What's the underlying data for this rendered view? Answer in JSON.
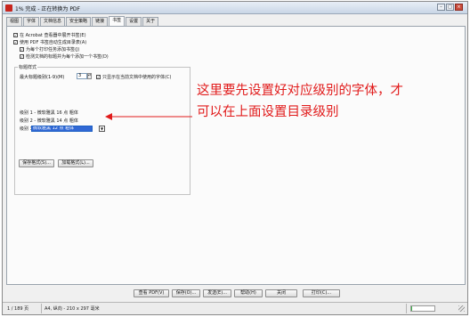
{
  "window": {
    "title": "1% 完成 - 正在转换为 PDF",
    "minimize_glyph": "–",
    "maximize_glyph": "□",
    "close_glyph": "×"
  },
  "tabs": [
    "视图",
    "字体",
    "文档信息",
    "安全策略",
    "链接",
    "书签",
    "设置",
    "关于"
  ],
  "active_tab": "书签",
  "bookmarks": {
    "options": [
      {
        "label": "在 Acrobat 查看器中展开书签(E)",
        "checked": true
      },
      {
        "label": "使用 PDF 书签自动生成目录表(A)",
        "checked": true
      },
      {
        "label": "为每个打印任务添加书签(J)",
        "checked": true
      },
      {
        "label": "检测文档的标题并为每个添加一个书签(D)",
        "checked": true
      }
    ],
    "heading_group": {
      "title": "标题样式",
      "max_level_label": "最大标题级别(1-9)(M)",
      "max_level_value": "3",
      "only_current_font_label": "只显示在当前文档中使用的字体(C)",
      "only_current_font_checked": true,
      "levels": [
        {
          "level_label": "级别 1 -",
          "font": "微软雅黑 16 点",
          "style": "粗体"
        },
        {
          "level_label": "级别 2 -",
          "font": "微软雅黑 14 点",
          "style": "粗体"
        },
        {
          "level_label": "级别 3 -",
          "font": "微软雅黑 12 点",
          "style": "粗体"
        }
      ],
      "save_format_label": "保存格式(S)...",
      "load_format_label": "加载格式(L)..."
    }
  },
  "annotation": {
    "line1": "这里要先设置好对应级别的字体，才",
    "line2": "可以在上面设置目录级别",
    "color": "#e11b1b"
  },
  "footer_buttons": [
    "查看 PDF(V)",
    "保存(O)...",
    "发送(E)...",
    "帮助(H)",
    "关闭",
    "打印(C)..."
  ],
  "status": {
    "page": "1 / 189 页",
    "paper": "A4, 纵向 - 210 x 297 毫米",
    "conversion_percent": 1
  }
}
